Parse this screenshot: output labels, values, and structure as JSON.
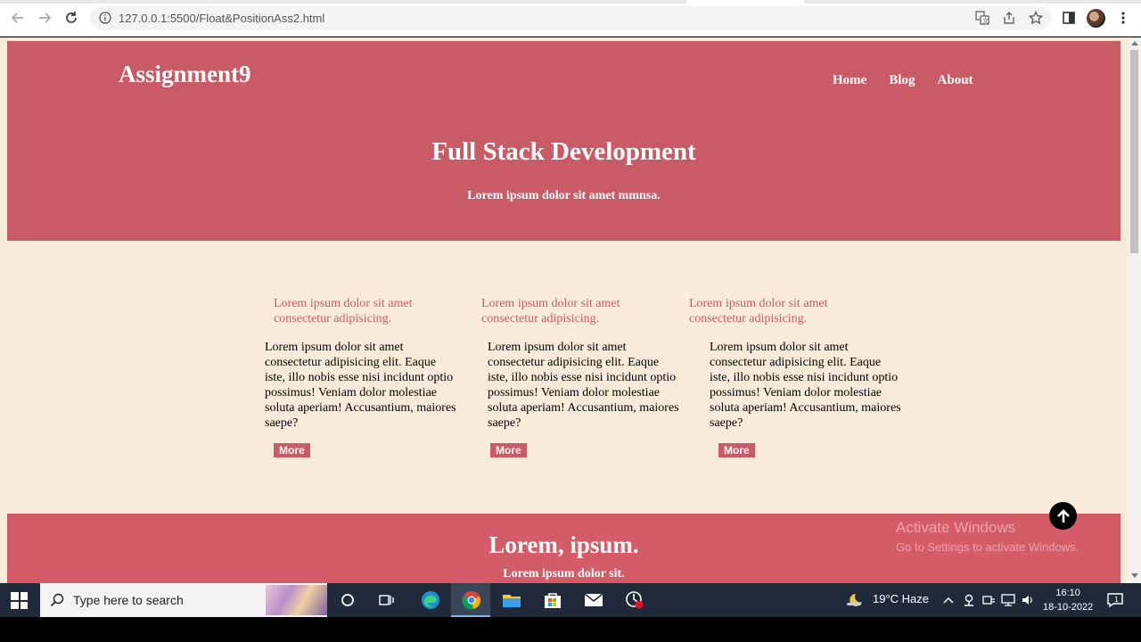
{
  "browser": {
    "url": "127.0.0.1:5500/Float&PositionAss2.html"
  },
  "site": {
    "logo": "Assignment9",
    "nav": [
      "Home",
      "Blog",
      "About"
    ],
    "hero_title": "Full Stack Development",
    "hero_subtitle": "Lorem ipsum dolor sit amet mmnsa."
  },
  "cards": [
    {
      "heading": "Lorem ipsum dolor sit amet consectetur adipisicing.",
      "body": "Lorem ipsum dolor sit amet consectetur adipisicing elit. Eaque iste, illo nobis esse nisi incidunt optio possimus! Veniam dolor molestiae soluta aperiam! Accusantium, maiores saepe?",
      "button": "More"
    },
    {
      "heading": "Lorem ipsum dolor sit amet consectetur adipisicing.",
      "body": "Lorem ipsum dolor sit amet consectetur adipisicing elit. Eaque iste, illo nobis esse nisi incidunt optio possimus! Veniam dolor molestiae soluta aperiam! Accusantium, maiores saepe?",
      "button": "More"
    },
    {
      "heading": "Lorem ipsum dolor sit amet consectetur adipisicing.",
      "body": "Lorem ipsum dolor sit amet consectetur adipisicing elit. Eaque iste, illo nobis esse nisi incidunt optio possimus! Veniam dolor molestiae soluta aperiam! Accusantium, maiores saepe?",
      "button": "More"
    }
  ],
  "footer": {
    "title": "Lorem, ipsum.",
    "subtitle": "Lorem ipsum dolor sit."
  },
  "watermark": {
    "line1": "Activate Windows",
    "line2": "Go to Settings to activate Windows."
  },
  "taskbar": {
    "search_placeholder": "Type here to search",
    "weather": "19°C  Haze",
    "time": "16:10",
    "date": "18-10-2022",
    "notifications": "1"
  },
  "colors": {
    "hero": "#c95b67",
    "page_bg": "#f9ebd9",
    "footer": "#d45b68"
  }
}
